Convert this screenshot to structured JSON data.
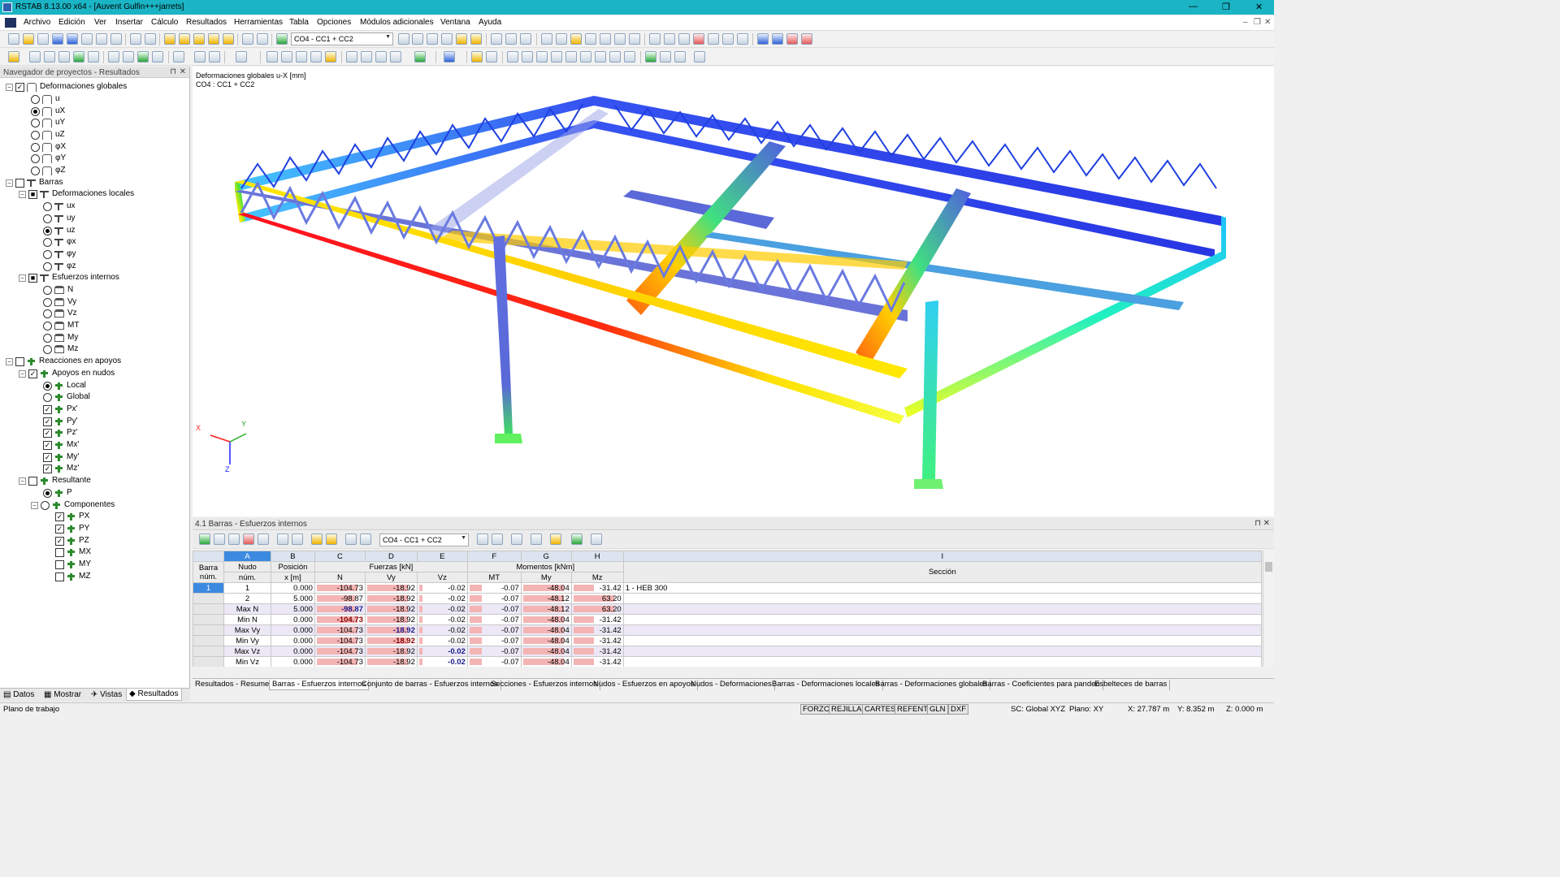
{
  "window": {
    "title": "RSTAB 8.13.00 x64 - [Auvent Gulfin+++jarrets]",
    "minimize": "—",
    "restore": "❐",
    "close": "✕"
  },
  "menu": [
    "Archivo",
    "Edición",
    "Ver",
    "Insertar",
    "Cálculo",
    "Resultados",
    "Herramientas",
    "Tabla",
    "Opciones",
    "Módulos adicionales",
    "Ventana",
    "Ayuda"
  ],
  "toolbar": {
    "loadcase_combo": "CO4 - CC1 + CC2"
  },
  "navigator": {
    "title": "Navegador de proyectos - Resultados",
    "tree": [
      {
        "l": "Deformaciones globales"
      },
      {
        "l": "u"
      },
      {
        "l": "uX"
      },
      {
        "l": "uY"
      },
      {
        "l": "uZ"
      },
      {
        "l": "φX"
      },
      {
        "l": "φY"
      },
      {
        "l": "φZ"
      },
      {
        "l": "Barras"
      },
      {
        "l": "Deformaciones locales"
      },
      {
        "l": "ux"
      },
      {
        "l": "uy"
      },
      {
        "l": "uz"
      },
      {
        "l": "φx"
      },
      {
        "l": "φy"
      },
      {
        "l": "φz"
      },
      {
        "l": "Esfuerzos internos"
      },
      {
        "l": "N"
      },
      {
        "l": "Vy"
      },
      {
        "l": "Vz"
      },
      {
        "l": "MT"
      },
      {
        "l": "My"
      },
      {
        "l": "Mz"
      },
      {
        "l": "Reacciones en apoyos"
      },
      {
        "l": "Apoyos en nudos"
      },
      {
        "l": "Local"
      },
      {
        "l": "Global"
      },
      {
        "l": "Px'"
      },
      {
        "l": "Py'"
      },
      {
        "l": "Pz'"
      },
      {
        "l": "Mx'"
      },
      {
        "l": "My'"
      },
      {
        "l": "Mz'"
      },
      {
        "l": "Resultante"
      },
      {
        "l": "P"
      },
      {
        "l": "Componentes"
      },
      {
        "l": "PX"
      },
      {
        "l": "PY"
      },
      {
        "l": "PZ"
      },
      {
        "l": "MX"
      },
      {
        "l": "MY"
      },
      {
        "l": "MZ"
      }
    ],
    "tabs": [
      "Datos",
      "Mostrar",
      "Vistas",
      "Resultados"
    ]
  },
  "view": {
    "label1": "Deformaciones globales u-X [mm]",
    "label2": "CO4 : CC1 + CC2",
    "axis_x": "X",
    "axis_y": "Y",
    "axis_z": "Z"
  },
  "table": {
    "title": "4.1 Barras - Esfuerzos internos",
    "combo": "CO4 - CC1 + CC2",
    "col_letters": [
      "A",
      "B",
      "C",
      "D",
      "E",
      "F",
      "G",
      "H",
      "I"
    ],
    "h_barra": "Barra",
    "h_num": "núm.",
    "h_nudo": "Nudo",
    "h_nudo2": "núm.",
    "h_pos": "Posición",
    "h_pos2": "x [m]",
    "h_fuerzas": "Fuerzas [kN]",
    "h_momentos": "Momentos [kNm]",
    "h_N": "N",
    "h_Vy": "Vy",
    "h_Vz": "Vz",
    "h_MT": "MT",
    "h_My": "My",
    "h_Mz": "Mz",
    "h_seccion": "Sección",
    "rows": [
      {
        "barra": "1",
        "nudo": "1",
        "x": "0.000",
        "N": "-104.73",
        "Vy": "-18.92",
        "Vz": "-0.02",
        "MT": "-0.07",
        "My": "-48.04",
        "Mz": "-31.42",
        "sec": "1 - HEB 300"
      },
      {
        "barra": "",
        "nudo": "2",
        "x": "5.000",
        "N": "-98.87",
        "Vy": "-18.92",
        "Vz": "-0.02",
        "MT": "-0.07",
        "My": "-48.12",
        "Mz": "63.20",
        "sec": ""
      },
      {
        "barra": "",
        "nudo": "Max N",
        "x": "5.000",
        "N": "-98.87",
        "Vy": "-18.92",
        "Vz": "-0.02",
        "MT": "-0.07",
        "My": "-48.12",
        "Mz": "63.20",
        "sec": ""
      },
      {
        "barra": "",
        "nudo": "Min N",
        "x": "0.000",
        "N": "-104.73",
        "Vy": "-18.92",
        "Vz": "-0.02",
        "MT": "-0.07",
        "My": "-48.04",
        "Mz": "-31.42",
        "sec": ""
      },
      {
        "barra": "",
        "nudo": "Max Vy",
        "x": "0.000",
        "N": "-104.73",
        "Vy": "-18.92",
        "Vz": "-0.02",
        "MT": "-0.07",
        "My": "-48.04",
        "Mz": "-31.42",
        "sec": ""
      },
      {
        "barra": "",
        "nudo": "Min Vy",
        "x": "0.000",
        "N": "-104.73",
        "Vy": "-18.92",
        "Vz": "-0.02",
        "MT": "-0.07",
        "My": "-48.04",
        "Mz": "-31.42",
        "sec": ""
      },
      {
        "barra": "",
        "nudo": "Max Vz",
        "x": "0.000",
        "N": "-104.73",
        "Vy": "-18.92",
        "Vz": "-0.02",
        "MT": "-0.07",
        "My": "-48.04",
        "Mz": "-31.42",
        "sec": ""
      },
      {
        "barra": "",
        "nudo": "Min Vz",
        "x": "0.000",
        "N": "-104.73",
        "Vy": "-18.92",
        "Vz": "-0.02",
        "MT": "-0.07",
        "My": "-48.04",
        "Mz": "-31.42",
        "sec": ""
      }
    ],
    "sheets": [
      "Resultados - Resumen",
      "Barras - Esfuerzos internos",
      "Conjunto de barras - Esfuerzos internos",
      "Secciones - Esfuerzos internos",
      "Nudos - Esfuerzos en apoyos",
      "Nudos - Deformaciones",
      "Barras - Deformaciones locales",
      "Barras - Deformaciones globales",
      "Barras - Coeficientes para pandeo",
      "Esbelteces de barras"
    ]
  },
  "status": {
    "left": "Plano de trabajo",
    "buttons": [
      "FORZC",
      "REJILLA",
      "CARTES",
      "REFENT",
      "GLN",
      "DXF"
    ],
    "sc": "SC: Global XYZ",
    "plano": "Plano: XY",
    "x": "X:  27.787 m",
    "y": "Y:  8.352 m",
    "z": "Z:  0.000 m"
  },
  "colors": {
    "titlebar": "#1ab4c4",
    "selection": "#3c8ae0",
    "bar_fill": "#f4b4b4"
  }
}
